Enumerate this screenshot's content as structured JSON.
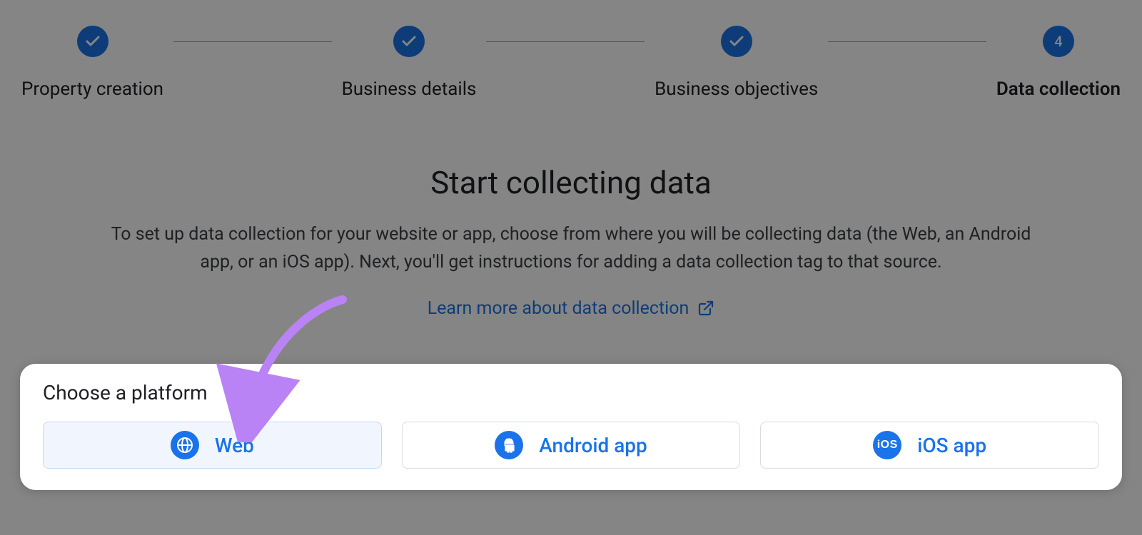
{
  "stepper": {
    "steps": [
      {
        "label": "Property creation",
        "state": "done"
      },
      {
        "label": "Business details",
        "state": "done"
      },
      {
        "label": "Business objectives",
        "state": "done"
      },
      {
        "label": "Data collection",
        "state": "active",
        "number": "4"
      }
    ]
  },
  "hero": {
    "title": "Start collecting data",
    "description": "To set up data collection for your website or app, choose from where you will be collecting data (the Web, an Android app, or an iOS app). Next, you'll get instructions for adding a data collection tag to that source.",
    "learn_more": "Learn more about data collection"
  },
  "card": {
    "title": "Choose a platform",
    "platforms": [
      {
        "label": "Web",
        "icon": "globe",
        "selected": true
      },
      {
        "label": "Android app",
        "icon": "android",
        "selected": false
      },
      {
        "label": "iOS app",
        "icon": "ios",
        "selected": false
      }
    ]
  },
  "annotation": {
    "arrow_color": "#b983f5",
    "target": "platform-web"
  }
}
